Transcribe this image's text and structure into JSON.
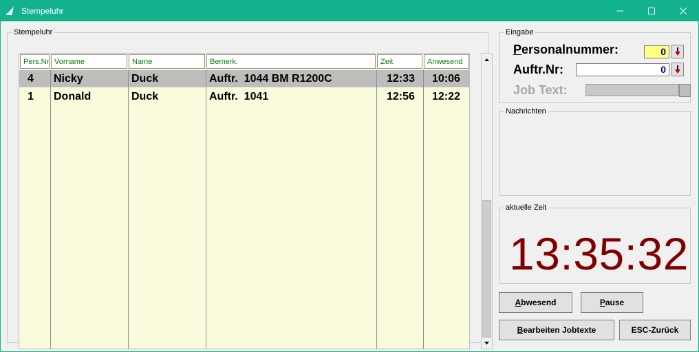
{
  "window": {
    "title": "Stempeluhr",
    "controls": {
      "minimize": "—",
      "maximize": "☐",
      "close": "✕"
    }
  },
  "stempeluhr": {
    "group_label": "Stempeluhr",
    "columns": [
      "Pers.Nr",
      "Vorname",
      "Name",
      "Bemerk.",
      "Zeit",
      "Anwesend"
    ],
    "rows": [
      [
        "4",
        "Nicky",
        "Duck",
        "Auftr.  1044 BM R1200C",
        "12:33",
        "10:06"
      ],
      [
        "1",
        "Donald",
        "Duck",
        "Auftr.  1041",
        "12:56",
        "12:22"
      ]
    ],
    "selected_row": 0
  },
  "eingabe": {
    "group_label": "Eingabe",
    "personalnummer": {
      "label_first": "P",
      "label_rest": "ersonalnummer:",
      "value": "0"
    },
    "auftrnr": {
      "label": "Auftr.Nr:",
      "value": "0"
    },
    "jobtext": {
      "label": "Job Text:"
    }
  },
  "nachrichten": {
    "group_label": "Nachrichten"
  },
  "zeit": {
    "group_label": "aktuelle Zeit",
    "value": "13:35:32"
  },
  "buttons": {
    "abwesend": {
      "first": "A",
      "rest": "bwesend"
    },
    "pause": {
      "first": "P",
      "rest": "ause"
    },
    "bearbeiten": {
      "first": "B",
      "rest": "earbeiten Jobtexte"
    },
    "esc": {
      "label": "ESC-Zurück"
    }
  },
  "colors": {
    "titlebar": "#13b28e",
    "grid_bg": "#fafadc",
    "header_text": "#0f7a0f",
    "selection": "#bdbdbd",
    "clock": "#800000",
    "pers_field_bg": "#ffff80",
    "field_text": "#000080"
  }
}
